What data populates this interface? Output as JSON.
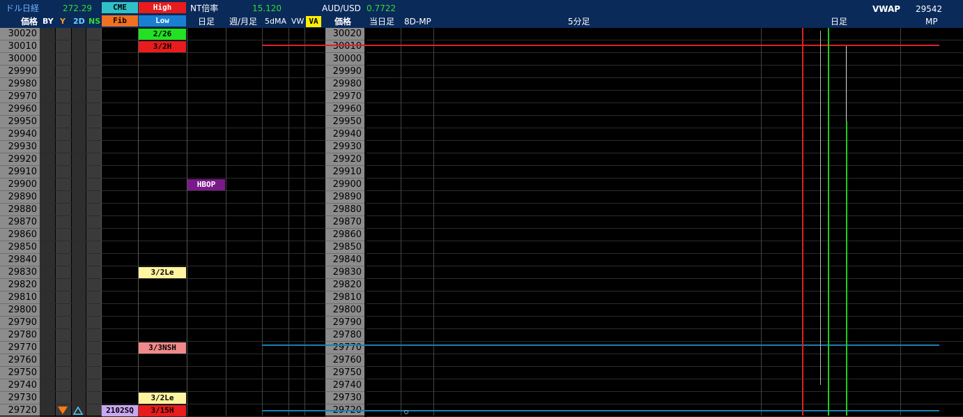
{
  "header": {
    "dollar_nikkei_label": "ドル日経",
    "dollar_nikkei_value": "272.29",
    "cme_label": "CME",
    "high_label": "High",
    "fib_label": "Fib",
    "low_label": "Low",
    "nt_label": "NT倍率",
    "nt_value": "15.120",
    "aud_label": "AUD/USD",
    "aud_value": "0.7722",
    "vwap_label": "VWAP",
    "vwap_value": "29542"
  },
  "columns": {
    "price": "価格",
    "by": "BY",
    "y": "Y",
    "two_d": "2D",
    "ns": "NS",
    "daily": "日足",
    "weekly_monthly": "週/月足",
    "five_dma": "5dMA",
    "vw": "VW",
    "va": "VA",
    "price2": "価格",
    "today": "当日足",
    "eight_d_mp": "8D-MP",
    "five_min": "5分足",
    "daily2": "日足",
    "mp": "MP"
  },
  "prices": [
    "30020",
    "30010",
    "30000",
    "29990",
    "29980",
    "29970",
    "29960",
    "29950",
    "29940",
    "29930",
    "29920",
    "29910",
    "29900",
    "29890",
    "29880",
    "29870",
    "29860",
    "29850",
    "29840",
    "29830",
    "29820",
    "29810",
    "29800",
    "29790",
    "29780",
    "29770",
    "29760",
    "29750",
    "29740",
    "29730",
    "29720"
  ],
  "tags": {
    "t226": "2/26",
    "t32h": "3/2H",
    "hbop": "HBOP",
    "t32le_a": "3/2Le",
    "t33nsh": "3/3NSH",
    "t32le_b": "3/2Le",
    "t2102sq": "2102SQ",
    "t315h": "3/15H"
  },
  "colors": {
    "header_bg": "#0a2a5a",
    "red_line": "#e02020",
    "green_line": "#22cc22",
    "blue_line": "#1a7fb0",
    "price_col_bg": "#8c8c8c"
  },
  "icons": {
    "y_marker": "triangle-down-orange-icon",
    "twod_marker": "triangle-up-cyan-icon"
  }
}
